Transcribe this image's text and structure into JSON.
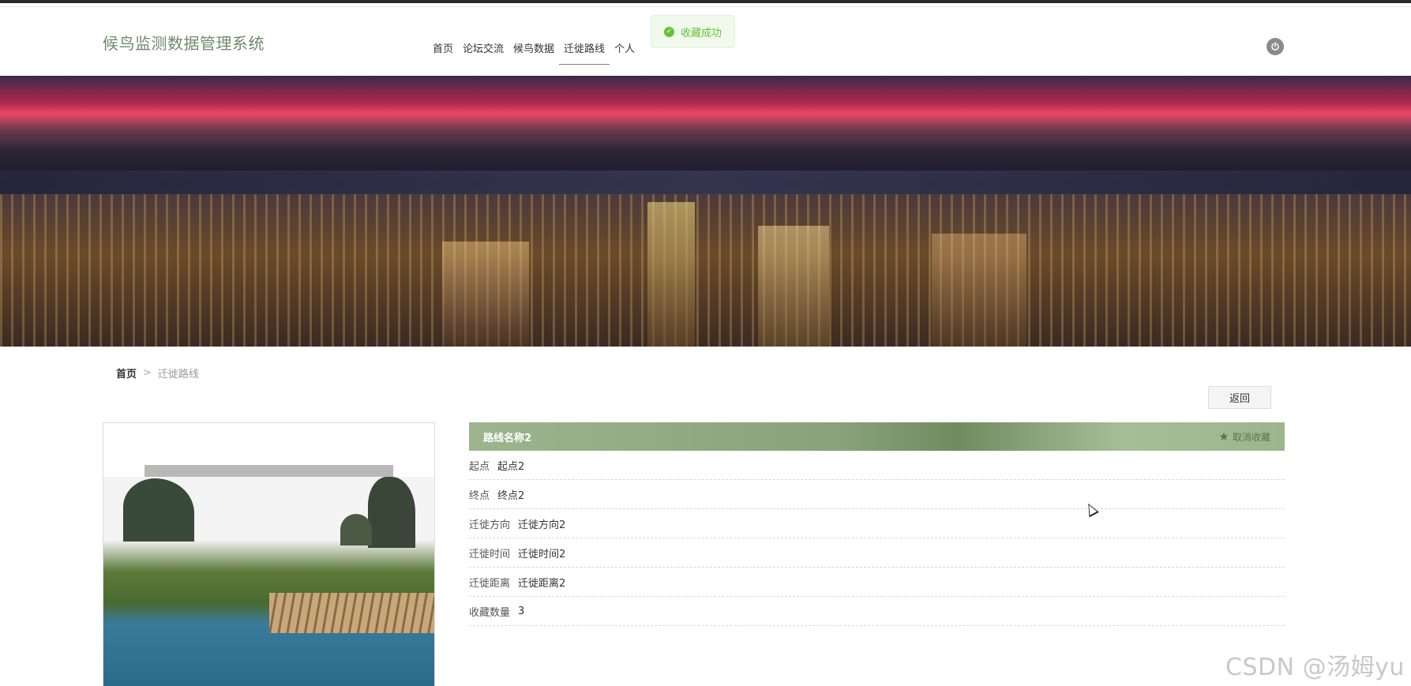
{
  "header": {
    "brand": "候鸟监测数据管理系统",
    "nav": [
      {
        "label": "首页"
      },
      {
        "label": "论坛交流"
      },
      {
        "label": "候鸟数据"
      },
      {
        "label": "迁徙路线",
        "active": true
      },
      {
        "label": "个人"
      }
    ],
    "power_icon": "power-icon"
  },
  "toast": {
    "text": "收藏成功",
    "icon": "check-circle-icon",
    "color": "#67c23a"
  },
  "breadcrumb": {
    "home": "首页",
    "separator": ">",
    "current": "迁徙路线"
  },
  "actions": {
    "back_label": "返回"
  },
  "detail": {
    "title": "路线名称2",
    "unfavorite_label": "取消收藏",
    "fields": [
      {
        "key": "起点",
        "value": "起点2"
      },
      {
        "key": "终点",
        "value": "终点2"
      },
      {
        "key": "迁徙方向",
        "value": "迁徙方向2"
      },
      {
        "key": "迁徙时间",
        "value": "迁徙时间2"
      },
      {
        "key": "迁徙距离",
        "value": "迁徙距离2"
      },
      {
        "key": "收藏数量",
        "value": "3"
      }
    ]
  },
  "watermark": "CSDN @汤姆yu",
  "colors": {
    "brand": "#6f8a6c",
    "panel_header": "#8aa27c",
    "success": "#67c23a"
  }
}
